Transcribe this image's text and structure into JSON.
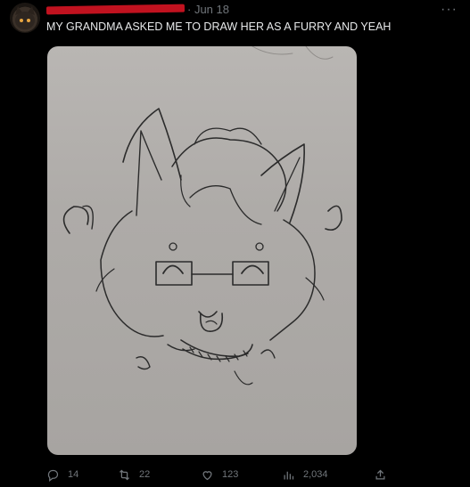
{
  "tweet": {
    "date": "· Jun 18",
    "more_label": "···",
    "text": "MY GRANDMA ASKED ME TO DRAW HER AS A FURRY AND YEAH"
  },
  "actions": {
    "replies": "14",
    "reposts": "22",
    "likes": "123",
    "views": "2,034"
  },
  "icons": {
    "reply": "reply-icon",
    "repost": "repost-icon",
    "like": "like-icon",
    "views": "views-icon",
    "share": "share-icon"
  },
  "colors": {
    "background": "#000000",
    "text": "#e7e9ea",
    "muted": "#71767b",
    "redaction": "#c1121f"
  }
}
